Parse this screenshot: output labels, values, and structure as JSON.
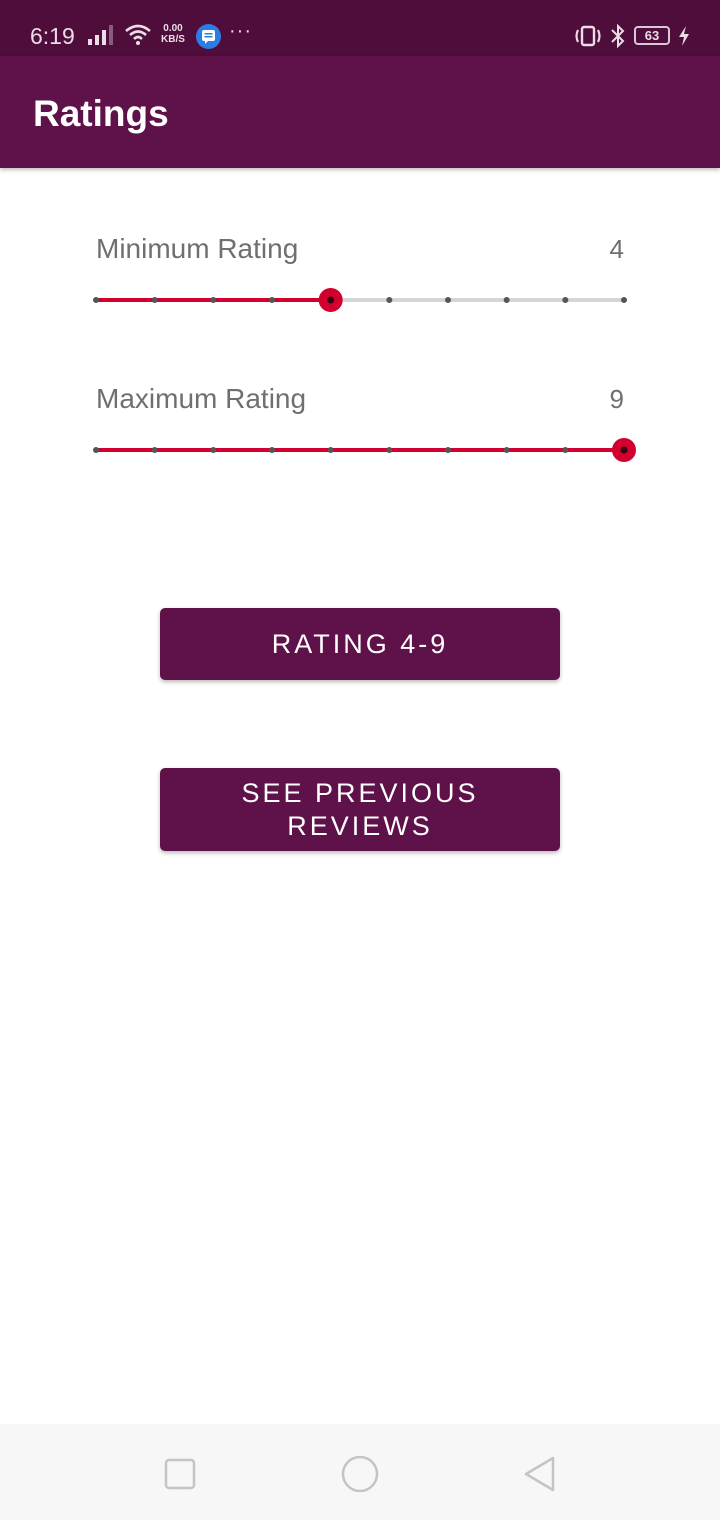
{
  "status_bar": {
    "time": "6:19",
    "net_speed_value": "0.00",
    "net_speed_unit": "KB/S",
    "overflow_indicator": "···",
    "battery_level": "63",
    "icons": [
      "signal-icon",
      "wifi-icon",
      "messages-icon",
      "vibrate-icon",
      "bluetooth-icon",
      "battery-icon",
      "charging-icon"
    ]
  },
  "app_bar": {
    "title": "Ratings"
  },
  "min_slider": {
    "label": "Minimum Rating",
    "value": "4",
    "min": 0,
    "max": 9,
    "current": 4
  },
  "max_slider": {
    "label": "Maximum Rating",
    "value": "9",
    "min": 0,
    "max": 9,
    "current": 9
  },
  "buttons": {
    "rating_label": "RATING 4-9",
    "previous_label": "SEE PREVIOUS REVIEWS"
  },
  "colors": {
    "primary": "#5f114a",
    "status_bar": "#4e0d3a",
    "slider_active": "#d2002f",
    "slider_inactive": "#d6d6d6",
    "tick": "#555555",
    "label_text": "#6f6f6f"
  },
  "nav_bar": {
    "icons": [
      "recent-apps-icon",
      "home-icon",
      "back-icon"
    ]
  }
}
